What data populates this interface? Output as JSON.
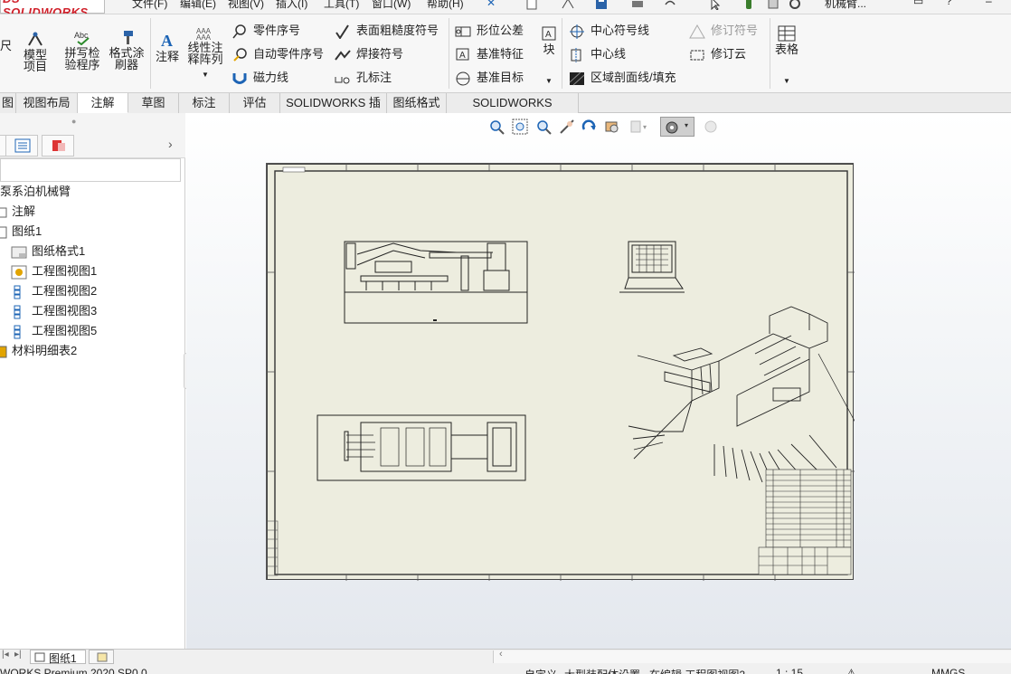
{
  "app": {
    "logo_text": "SOLIDWORKS",
    "doc_title": "机械臂..."
  },
  "menu": [
    "文件(F)",
    "编辑(E)",
    "视图(V)",
    "插入(I)",
    "工具(T)",
    "窗口(W)",
    "帮助(H)"
  ],
  "ribbon": {
    "dim_fragment": "尺",
    "model_items": "模型项目",
    "spell_check": "拼写检验程序",
    "format_painter": "格式涂刷器",
    "note": "注释",
    "linear_note_pattern": "线性注释阵列",
    "balloon": "零件序号",
    "auto_balloon": "自动零件序号",
    "magnetic_line": "磁力线",
    "surface_finish": "表面粗糙度符号",
    "weld_symbol": "焊接符号",
    "hole_callout": "孔标注",
    "geometric_tolerance": "形位公差",
    "datum_feature": "基准特征",
    "datum_target": "基准目标",
    "block": "块",
    "center_mark": "中心符号线",
    "centerline": "中心线",
    "area_hatch": "区域剖面线/填充",
    "revision_symbol": "修订符号",
    "revision_cloud": "修订云",
    "table": "表格"
  },
  "tabs": [
    {
      "label": "图",
      "active": false
    },
    {
      "label": "视图布局",
      "active": false
    },
    {
      "label": "注解",
      "active": true
    },
    {
      "label": "草图",
      "active": false
    },
    {
      "label": "标注",
      "active": false
    },
    {
      "label": "评估",
      "active": false
    },
    {
      "label": "SOLIDWORKS 插件",
      "active": false
    },
    {
      "label": "图纸格式",
      "active": false
    },
    {
      "label": "SOLIDWORKS Inspection",
      "active": false
    }
  ],
  "tree": {
    "root": "泵系泊机械臂",
    "items": [
      {
        "label": "注解",
        "indent": 0
      },
      {
        "label": "图纸1",
        "indent": 0
      },
      {
        "label": "图纸格式1",
        "indent": 1
      },
      {
        "label": "工程图视图1",
        "indent": 1
      },
      {
        "label": "工程图视图2",
        "indent": 1
      },
      {
        "label": "工程图视图3",
        "indent": 1
      },
      {
        "label": "工程图视图5",
        "indent": 1
      },
      {
        "label": "材料明细表2",
        "indent": 0
      }
    ]
  },
  "sheet_tab": "图纸1",
  "status": {
    "product": "WORKS Premium 2020 SP0.0",
    "custom": "自定义",
    "message": "大型装配体设置",
    "editing": "在编辑 工程图视图2",
    "scale": "1 : 15",
    "units": "MMGS"
  },
  "colors": {
    "logo_red": "#d0202a",
    "sheet_bg": "#ededdf",
    "accent_blue": "#1d64b5"
  }
}
